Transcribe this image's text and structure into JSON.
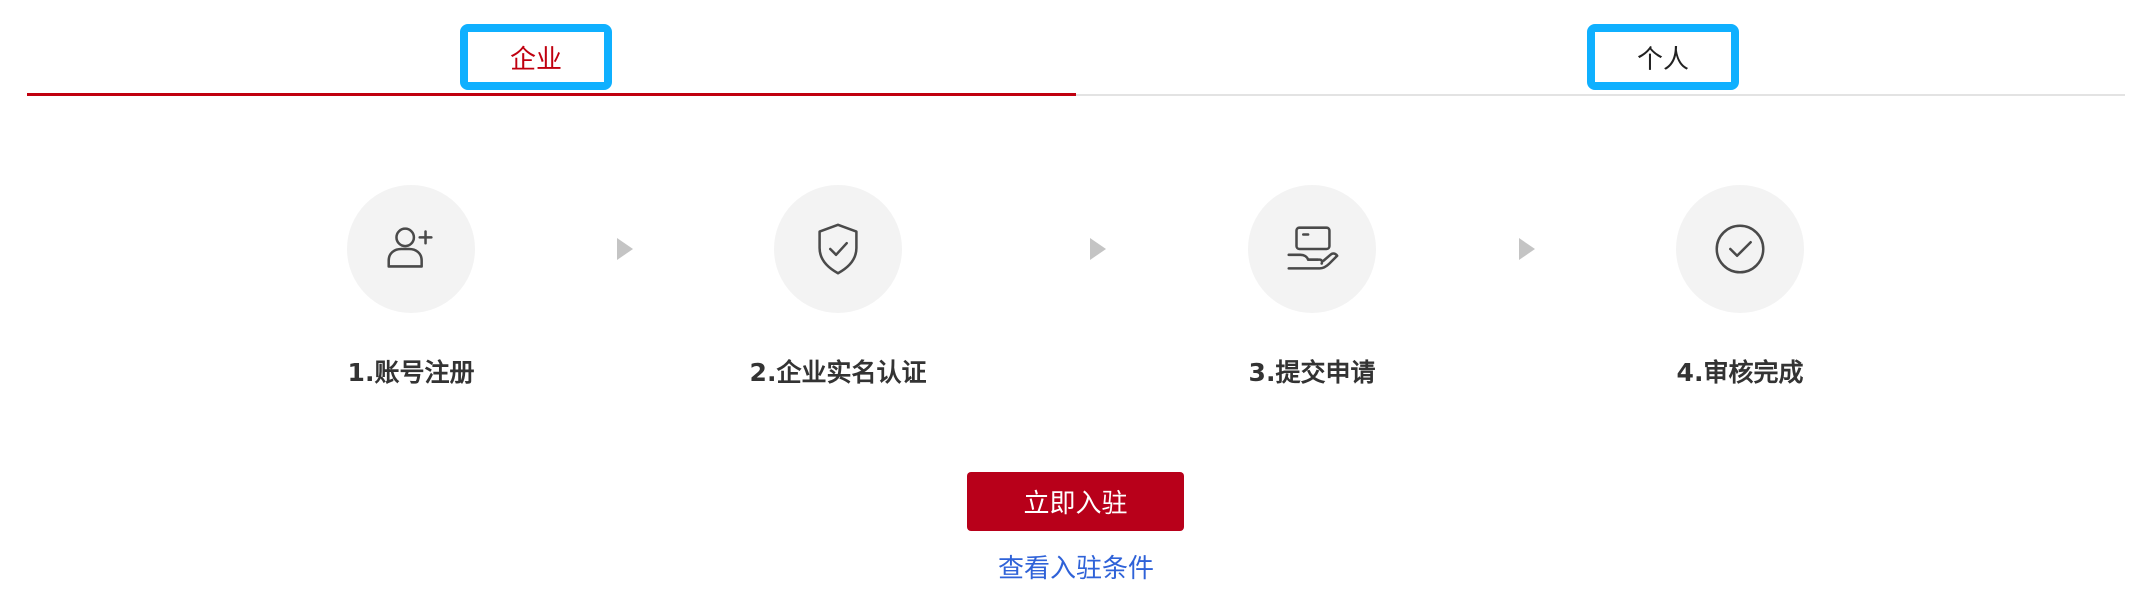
{
  "tabs": [
    {
      "label": "企业",
      "active": true
    },
    {
      "label": "个人",
      "active": false
    }
  ],
  "steps": [
    {
      "label": "1.账号注册",
      "icon": "user-add-icon"
    },
    {
      "label": "2.企业实名认证",
      "icon": "shield-check-icon"
    },
    {
      "label": "3.提交申请",
      "icon": "hand-card-icon"
    },
    {
      "label": "4.审核完成",
      "icon": "check-circle-icon"
    }
  ],
  "actions": {
    "join_label": "立即入驻",
    "conditions_label": "查看入驻条件"
  },
  "colors": {
    "accent": "#c0000f",
    "button": "#b8001a",
    "link": "#2f62d8",
    "highlight_box": "#0fb0ff",
    "icon_bg": "#f3f3f3",
    "arrow": "#c4c4c4"
  }
}
